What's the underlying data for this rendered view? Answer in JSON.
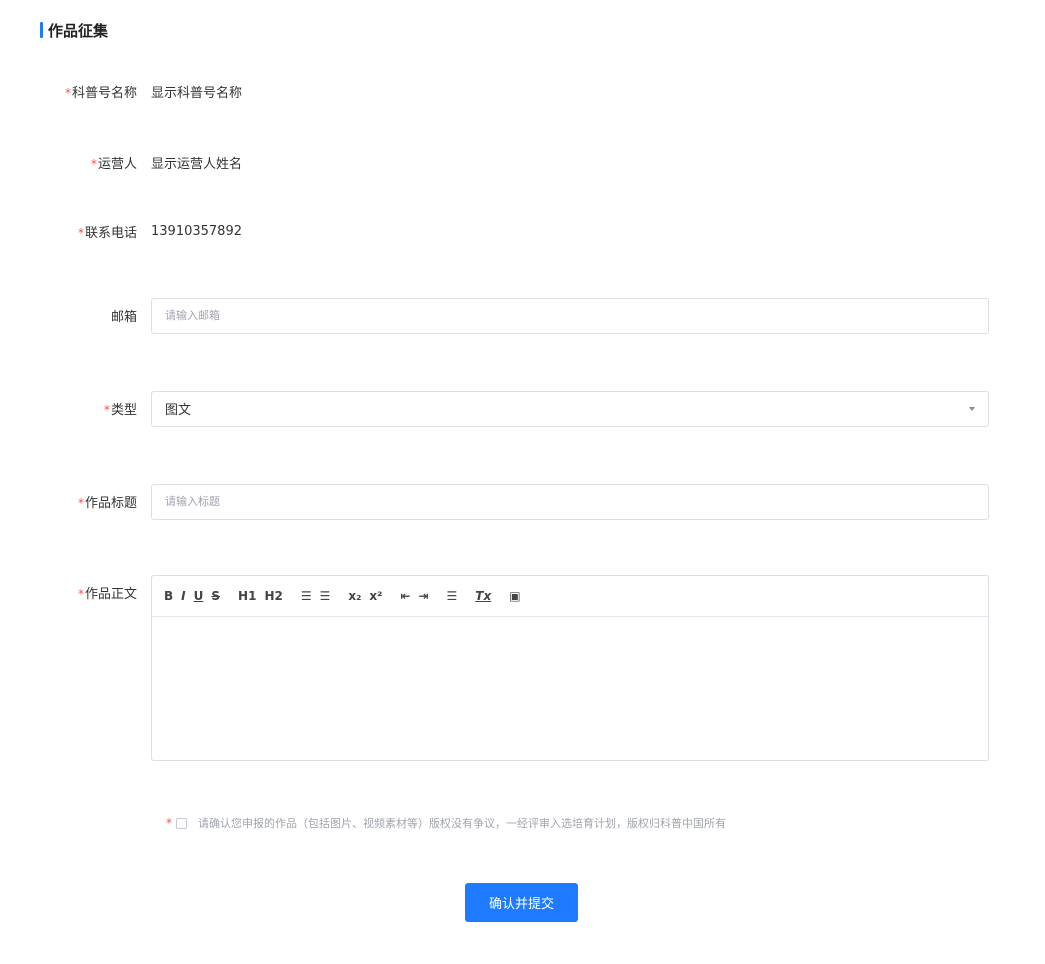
{
  "section": {
    "title": "作品征集"
  },
  "required_mark": "*",
  "form": {
    "name": {
      "label": "科普号名称",
      "value": "显示科普号名称"
    },
    "operator": {
      "label": "运营人",
      "value": "显示运营人姓名"
    },
    "phone": {
      "label": "联系电话",
      "value": "13910357892"
    },
    "email": {
      "label": "邮箱",
      "placeholder": "请输入邮箱"
    },
    "type": {
      "label": "类型",
      "value": "图文"
    },
    "title": {
      "label": "作品标题",
      "placeholder": "请输入标题"
    },
    "body": {
      "label": "作品正文"
    }
  },
  "toolbar": {
    "bold": "B",
    "italic": "I",
    "underline": "U",
    "strike": "S",
    "h1": "H1",
    "h2": "H2",
    "ordered_list": "☰",
    "bullet_list": "☰",
    "subscript": "x₂",
    "superscript": "x²",
    "outdent": "⇤",
    "indent": "⇥",
    "align": "☰",
    "clean": "Tx",
    "image": "▣"
  },
  "agreement": {
    "text": "请确认您申报的作品（包括图片、视频素材等）版权没有争议，一经评审入选培育计划，版权归科普中国所有"
  },
  "submit": {
    "label": "确认并提交"
  },
  "colors": {
    "accent": "#1e7bff",
    "required": "#ff4d4f",
    "border": "#dcdfe6"
  }
}
